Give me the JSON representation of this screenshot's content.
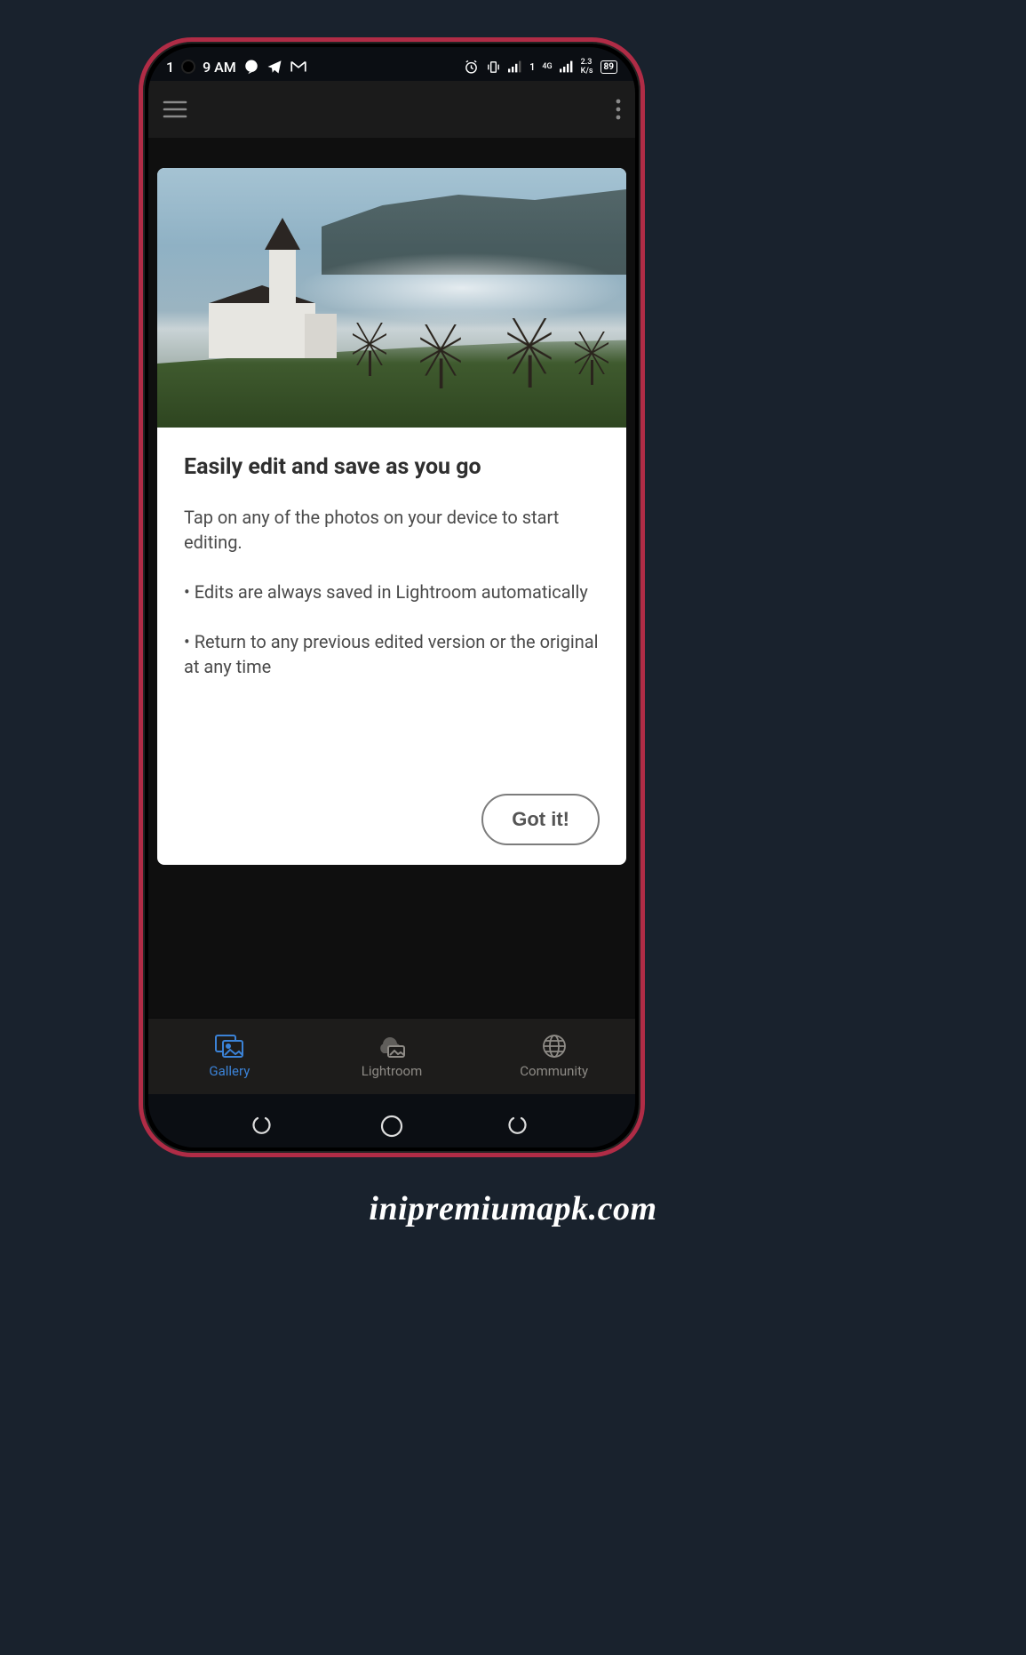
{
  "status_bar": {
    "time_prefix": "1",
    "time": "9 AM",
    "chat_icon": "chat-bubble-icon",
    "telegram_icon": "telegram-icon",
    "gmail_icon": "gmail-icon",
    "alarm_icon": "alarm-icon",
    "vibrate_icon": "vibrate-icon",
    "signal1_icon": "signal-icon",
    "sim_slot": "1",
    "signal2_label_top": "4G",
    "signal2_icon": "signal-icon",
    "speed_top": "2.3",
    "speed_bottom": "K/s",
    "battery_pct": "89"
  },
  "header": {
    "menu_icon": "hamburger-icon",
    "overflow_icon": "kebab-icon"
  },
  "onboarding_card": {
    "image_alt": "landscape-church",
    "title": "Easily edit and save as you go",
    "intro": "Tap on any of the photos on your device to start editing.",
    "bullet1": "• Edits are always saved in Lightroom automatically",
    "bullet2": "• Return to any previous edited version or the original at any time",
    "action_label": "Got it!"
  },
  "bottom_nav": {
    "items": [
      {
        "label": "Gallery",
        "icon": "gallery-icon",
        "active": true
      },
      {
        "label": "Lightroom",
        "icon": "cloud-photo-icon",
        "active": false
      },
      {
        "label": "Community",
        "icon": "globe-icon",
        "active": false
      }
    ]
  },
  "sys_nav": {
    "recent_icon": "recent-apps-icon",
    "home_icon": "home-circle-icon",
    "back_icon": "back-icon"
  },
  "watermark": "inipremiumapk.com",
  "colors": {
    "accent": "#3b82d6",
    "frame": "#b02c46",
    "bg": "#19222d"
  }
}
